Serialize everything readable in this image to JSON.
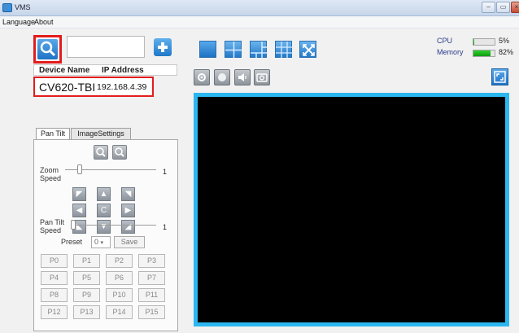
{
  "window": {
    "title": "VMS",
    "minimize_label": "–",
    "maximize_label": "▭",
    "close_label": "×"
  },
  "menu": {
    "items": [
      "Language",
      "About"
    ]
  },
  "device_list": {
    "search_value": "",
    "columns": [
      "Device Name",
      "IP Address"
    ],
    "rows": [
      {
        "name": "CV620-TBI",
        "ip": "192.168.4.39"
      }
    ]
  },
  "tabs": [
    "Pan Tilt",
    "ImageSettings"
  ],
  "pan_tilt": {
    "zoom_speed_label": "Zoom",
    "zoom_speed_label2": "Speed",
    "zoom_speed_value": "1",
    "pan_tilt_speed_label": "Pan Tilt",
    "pan_tilt_speed_label2": "Speed",
    "pan_tilt_speed_value": "1",
    "center_label": "C",
    "preset_label": "Preset",
    "preset_value": "0",
    "save_label": "Save",
    "presets": [
      "P0",
      "P1",
      "P2",
      "P3",
      "P4",
      "P5",
      "P6",
      "P7",
      "P8",
      "P9",
      "P10",
      "P11",
      "P12",
      "P13",
      "P14",
      "P15"
    ]
  },
  "status": {
    "cpu_label": "CPU",
    "cpu_value": "5%",
    "cpu_fraction": 0.05,
    "memory_label": "Memory",
    "memory_value": "82%",
    "memory_fraction": 0.82
  },
  "colors": {
    "accent": "#1e73c6",
    "highlight": "#e31c1c",
    "video_border": "#2bb7f0",
    "meter": "#16a91a"
  },
  "icons": [
    "search-icon",
    "plus-icon",
    "layout-1-icon",
    "layout-4-icon",
    "layout-6-icon",
    "layout-9-icon",
    "fullscreen-x-icon",
    "eye-icon",
    "record-icon",
    "speaker-icon",
    "snapshot-icon",
    "expand-icon",
    "zoom-in-icon",
    "zoom-out-icon",
    "arrow-icons"
  ]
}
